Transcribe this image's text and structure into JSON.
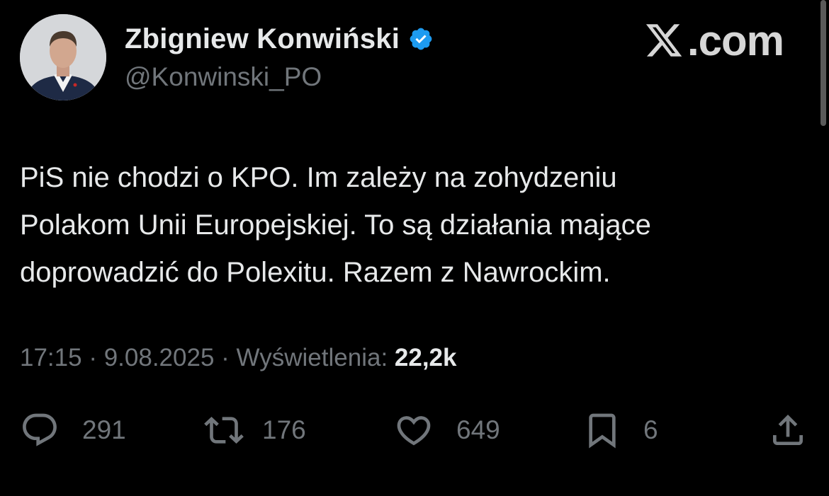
{
  "author": {
    "display_name": "Zbigniew Konwiński",
    "handle": "@Konwinski_PO",
    "verified": true
  },
  "brand": {
    "text": ".com"
  },
  "tweet": {
    "lines": [
      "PiS nie chodzi o KPO. Im zależy na zohydzeniu",
      "Polakom Unii Europejskiej. To są działania mające",
      "doprowadzić do Polexitu. Razem z Nawrockim."
    ]
  },
  "meta": {
    "time": "17:15",
    "separator": " · ",
    "date": "9.08.2025",
    "views_label": "Wyświetlenia: ",
    "views_count": "22,2k"
  },
  "actions": {
    "replies": "291",
    "reposts": "176",
    "likes": "649",
    "bookmarks": "6"
  },
  "colors": {
    "background": "#000000",
    "primary_text": "#e7e9ea",
    "secondary_text": "#71767b",
    "verified_badge": "#1d9bf0"
  }
}
